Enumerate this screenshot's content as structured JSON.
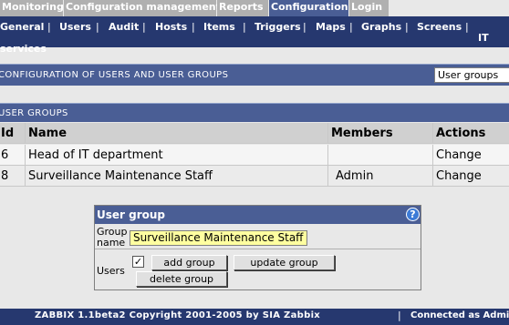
{
  "topnav": {
    "tabs": [
      "Monitoring",
      "Configuration management",
      "Reports",
      "Configuration",
      "Login"
    ],
    "active": "Configuration"
  },
  "subnav": {
    "items": [
      "General",
      "Users",
      "Audit",
      "Hosts",
      "Items",
      "Triggers",
      "Maps",
      "Graphs",
      "Screens",
      "IT services"
    ]
  },
  "configbar": {
    "title": "CONFIGURATION OF USERS AND USER GROUPS",
    "select_value": "User groups"
  },
  "usergroups": {
    "title": "USER GROUPS",
    "columns": [
      "Id",
      "Name",
      "Members",
      "Actions"
    ],
    "rows": [
      {
        "id": "6",
        "name": "Head of IT department",
        "members": "",
        "action": "Change"
      },
      {
        "id": "8",
        "name": "Surveillance Maintenance Staff",
        "members": "Admin",
        "action": "Change"
      }
    ]
  },
  "form": {
    "title": "User group",
    "help": "?",
    "group_name_label": "Group name",
    "group_name_value": "Surveillance Maintenance Staff",
    "users_label": "Users",
    "check_mark": "✓",
    "add_button": "add group",
    "update_button": "update group",
    "delete_button": "delete group"
  },
  "footer": {
    "copyright": "ZABBIX 1.1beta2 Copyright 2001-2005 by SIA Zabbix",
    "separator": "|",
    "connected": "Connected as Admin"
  },
  "colors": {
    "nav_dark": "#26386f",
    "header_blue": "#4a5e95",
    "tab_gray": "#b0b0b0",
    "input_yellow": "#ffffa0"
  }
}
